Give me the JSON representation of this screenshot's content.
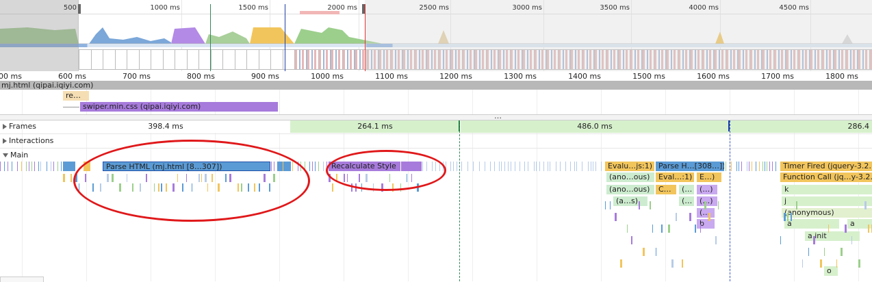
{
  "overview": {
    "tick_labels": [
      "500",
      "1000 ms",
      "1500 ms",
      "2000 ms",
      "2500 ms",
      "3000 ms",
      "3500 ms",
      "4000 ms",
      "4500 ms"
    ]
  },
  "main_ruler": {
    "labels": [
      "00 ms",
      "600 ms",
      "700 ms",
      "800 ms",
      "900 ms",
      "1000 ms",
      "1100 ms",
      "1200 ms",
      "1300 ms",
      "1400 ms",
      "1500 ms",
      "1600 ms",
      "1700 ms",
      "1800 ms"
    ]
  },
  "network": {
    "title": "mj.html (qipai.iqiyi.com)",
    "requests": [
      {
        "label": "re…",
        "color": "#f5deb3"
      },
      {
        "label": "swiper.min.css (qipai.iqiyi.com)",
        "color": "#a77bdc"
      }
    ]
  },
  "tracks": {
    "frames_label": "Frames",
    "interactions_label": "Interactions",
    "main_label": "Main",
    "frames": [
      "398.4 ms",
      "264.1 ms",
      "486.0 ms",
      "286.4"
    ]
  },
  "flame": {
    "parse_html": "Parse HTML (mj.html [8…307])",
    "recalc_style": "Recalculate Style",
    "col1": [
      "Evalu…js:1)",
      "(ano…ous)",
      "(ano…ous)",
      "(a…s)"
    ],
    "col2": [
      "Parse H…[308…])",
      "Eval…:1)",
      "C…",
      "(…",
      "(…",
      "E…)",
      "(…)",
      "(…)",
      "(…",
      "b"
    ],
    "col3": [
      "Timer Fired (jquery-3.2…",
      "Function Call (jq…y-3.2…",
      "k",
      "j",
      "(anonymous)",
      "a",
      "a",
      "a.init",
      "o"
    ]
  },
  "colors": {
    "script": "#f2c55c",
    "render": "#a77bdc",
    "loading": "#5b9bd5",
    "frame_green": "#d6f0cc",
    "annotation": "#e0181a"
  }
}
